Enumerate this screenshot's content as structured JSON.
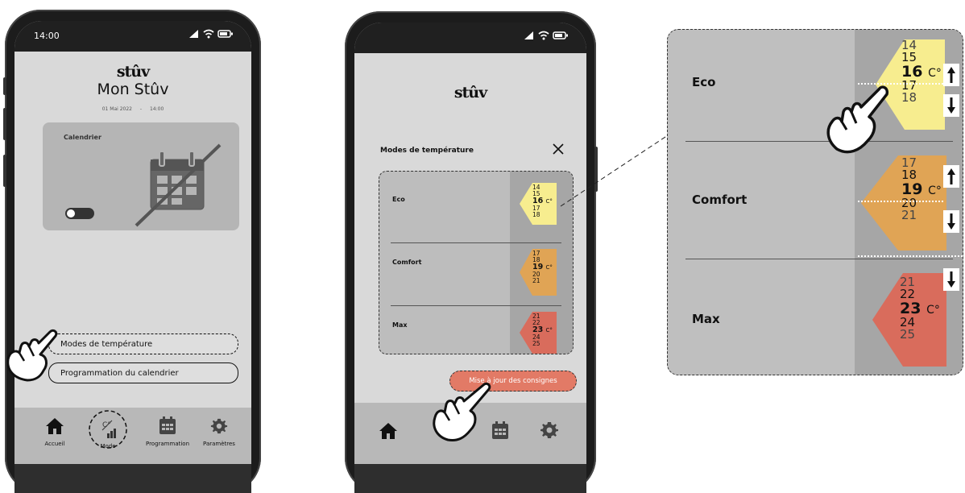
{
  "colors": {
    "eco": "#f7ed8f",
    "comfort": "#e0a455",
    "max": "#d96c5c",
    "update_button": "#e27a66"
  },
  "phone1": {
    "time": "14:00",
    "logo": "stûv",
    "title": "Mon Stûv",
    "date": "01 Mai 2022",
    "date_sep": "-",
    "date_time": "14:00",
    "calendar_card": {
      "label": "Calendrier",
      "icon": "calendar-crossed-icon",
      "toggle_state": "off"
    },
    "buttons": {
      "modes": "Modes de température",
      "schedule": "Programmation du calendrier"
    },
    "nav": [
      {
        "label": "Accueil",
        "icon": "home-icon"
      },
      {
        "label": "Mode",
        "icon": "thermometer-mode-icon"
      },
      {
        "label": "Programmation",
        "icon": "calendar-icon"
      },
      {
        "label": "Paramètres",
        "icon": "gear-icon"
      }
    ]
  },
  "phone2": {
    "logo": "stûv",
    "panel_title": "Modes de température",
    "close_icon": "close-icon",
    "modes": [
      {
        "name": "Eco",
        "values": [
          "14",
          "15",
          "16",
          "17",
          "18"
        ],
        "selected": "16",
        "unit": "C°"
      },
      {
        "name": "Comfort",
        "values": [
          "17",
          "18",
          "19",
          "20",
          "21"
        ],
        "selected": "19",
        "unit": "C°"
      },
      {
        "name": "Max",
        "values": [
          "21",
          "22",
          "23",
          "24",
          "25"
        ],
        "selected": "23",
        "unit": "C°"
      }
    ],
    "update_button": "Mise à jour des consignes"
  },
  "zoom": {
    "modes": [
      {
        "name": "Eco",
        "values": [
          "14",
          "15",
          "16",
          "17",
          "18"
        ],
        "selected": "16",
        "unit": "C°"
      },
      {
        "name": "Comfort",
        "values": [
          "17",
          "18",
          "19",
          "20",
          "21"
        ],
        "selected": "19",
        "unit": "C°"
      },
      {
        "name": "Max",
        "values": [
          "21",
          "22",
          "23",
          "24",
          "25"
        ],
        "selected": "23",
        "unit": "C°"
      }
    ],
    "arrows": [
      "arrow-up-icon",
      "arrow-down-icon"
    ]
  }
}
